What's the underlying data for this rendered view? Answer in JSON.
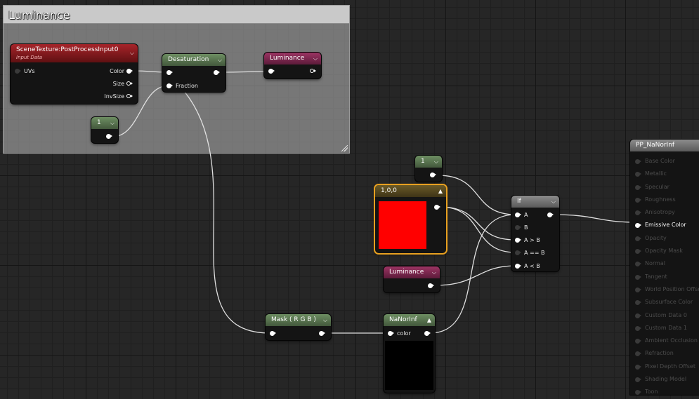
{
  "comment": {
    "title": "Luminance"
  },
  "nodes": {
    "scene_texture": {
      "title": "SceneTexture:PostProcessInput0",
      "subtitle": "Input Data",
      "inputs": [
        "UVs"
      ],
      "outputs": [
        "Color",
        "Size",
        "InvSize"
      ]
    },
    "desaturation": {
      "title": "Desaturation",
      "inputs": [
        "",
        "Fraction"
      ]
    },
    "luminance_top": {
      "title": "Luminance"
    },
    "const_1_a": {
      "title": "1"
    },
    "const_1_b": {
      "title": "1"
    },
    "vector_color": {
      "title": "1,0,0",
      "color": "#ff0000"
    },
    "luminance_mid": {
      "title": "Luminance"
    },
    "if_node": {
      "title": "If",
      "inputs": [
        "A",
        "B",
        "A > B",
        "A == B",
        "A < B"
      ]
    },
    "mask": {
      "title": "Mask ( R G B )"
    },
    "nanorinf": {
      "title": "NaNorInf",
      "input": "color",
      "preview_color": "#000000"
    }
  },
  "material": {
    "title": "PP_NaNorInf",
    "pins": [
      {
        "label": "Base Color",
        "active": false
      },
      {
        "label": "Metallic",
        "active": false
      },
      {
        "label": "Specular",
        "active": false
      },
      {
        "label": "Roughness",
        "active": false
      },
      {
        "label": "Anisotropy",
        "active": false
      },
      {
        "label": "Emissive Color",
        "active": true
      },
      {
        "label": "Opacity",
        "active": false
      },
      {
        "label": "Opacity Mask",
        "active": false
      },
      {
        "label": "Normal",
        "active": false
      },
      {
        "label": "Tangent",
        "active": false
      },
      {
        "label": "World Position Offset",
        "active": false
      },
      {
        "label": "Subsurface Color",
        "active": false
      },
      {
        "label": "Custom Data 0",
        "active": false
      },
      {
        "label": "Custom Data 1",
        "active": false
      },
      {
        "label": "Ambient Occlusion",
        "active": false
      },
      {
        "label": "Refraction",
        "active": false
      },
      {
        "label": "Pixel Depth Offset",
        "active": false
      },
      {
        "label": "Shading Model",
        "active": false
      },
      {
        "label": "Toon",
        "active": false
      }
    ]
  },
  "colors": {
    "grid_bg": "#262626",
    "selection": "#e8a020",
    "wire": "#e0e0e0"
  }
}
